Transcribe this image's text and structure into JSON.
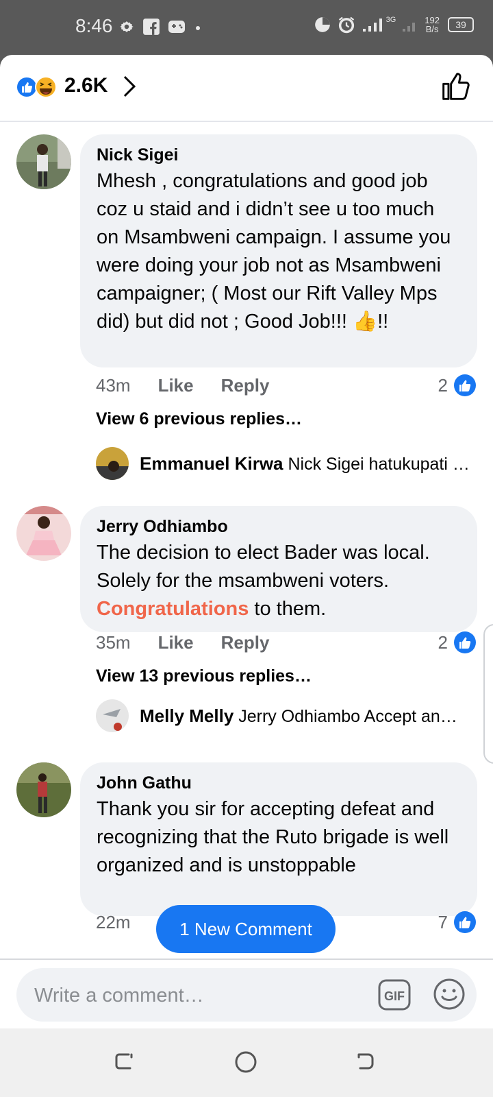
{
  "status_bar": {
    "time": "8:46",
    "speed_value": "192",
    "speed_unit": "B/s",
    "network": "3G",
    "battery": "39"
  },
  "header": {
    "reaction_count": "2.6K"
  },
  "comments": [
    {
      "author": "Nick Sigei",
      "text": "Mhesh , congratulations and good job coz u staid and i didn’t see u too much on Msambweni campaign. I assume you were doing your job not as Msambweni campaigner; ( Most our Rift Valley Mps did) but did not ; Good Job!!! 👍!!",
      "time": "43m",
      "like_label": "Like",
      "reply_label": "Reply",
      "likes": "2",
      "view_previous": "View 6 previous replies…",
      "reply_author": "Emmanuel Kirwa",
      "reply_preview": "Nick Sigei hatukupati …"
    },
    {
      "author": "Jerry Odhiambo",
      "text_before": "The decision to elect Bader was local. Solely for the msambweni voters. ",
      "text_highlight": "Congratulations",
      "text_after": " to them.",
      "time": "35m",
      "like_label": "Like",
      "reply_label": "Reply",
      "likes": "2",
      "view_previous": "View 13 previous replies…",
      "reply_author": "Melly Melly",
      "reply_preview": "Jerry Odhiambo Accept an…"
    },
    {
      "author": "John Gathu",
      "text": "Thank you sir for accepting defeat and recognizing that the Ruto brigade is well organized and is unstoppable",
      "time": "22m",
      "likes": "7"
    }
  ],
  "new_comment_button": "1 New Comment",
  "composer": {
    "placeholder": "Write a comment…",
    "gif_label": "GIF"
  },
  "colors": {
    "facebook_blue": "#1877f2",
    "highlight": "#f0664a",
    "bubble": "#f0f2f5"
  }
}
